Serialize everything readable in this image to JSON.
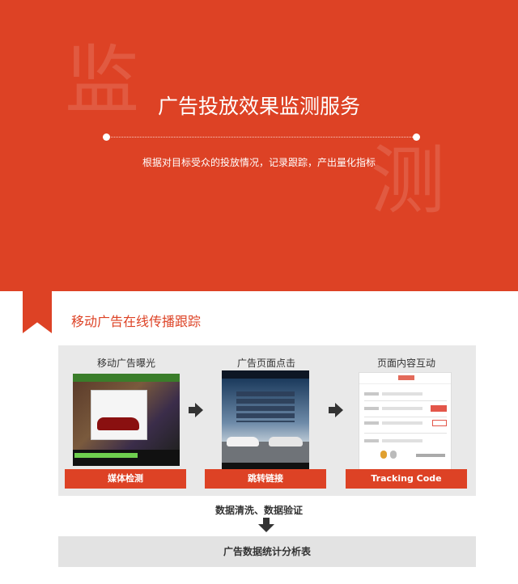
{
  "hero": {
    "watermark_1": "监",
    "watermark_2": "测",
    "title": "广告投放效果监测服务",
    "subtitle": "根据对目标受众的投放情况，记录跟踪，产出量化指标"
  },
  "section": {
    "title": "移动广告在线传播跟踪"
  },
  "steps": [
    {
      "title": "移动广告曝光",
      "button": "媒体检测"
    },
    {
      "title": "广告页面点击",
      "button": "跳转链接"
    },
    {
      "title": "页面内容互动",
      "button": "Tracking Code"
    }
  ],
  "process": {
    "clean_label": "数据清洗、数据验证",
    "result_label": "广告数据统计分析表"
  },
  "colors": {
    "brand_red": "#dd4225",
    "panel_gray": "#e9e9e9",
    "arrow": "#333333"
  },
  "icons": {
    "step_arrow": "right-arrow-icon",
    "down_arrow": "down-arrow-icon",
    "bookmark": "bookmark-icon"
  }
}
